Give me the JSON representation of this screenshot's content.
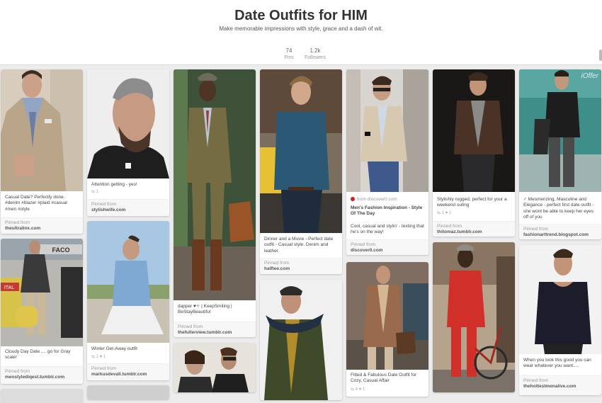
{
  "board": {
    "title": "Date Outfits for HIM",
    "description": "Make memorable impressions with style, grace and a dash of wit.",
    "pins_count": "74",
    "pins_label": "Pins",
    "followers_count": "1.2k",
    "followers_label": "Followers"
  },
  "pinned_from_label": "Pinned from",
  "pins": {
    "c1a": {
      "caption": "Casual Date? Perfectly done. #denim #blazer #plaid #casual #men #style",
      "source": "theultralinx.com"
    },
    "c1b": {
      "caption": "Cloudy Day Date .... go for Gray scale!",
      "source": "menstylediqest.tumblr.com"
    },
    "c2a": {
      "caption": "Attention getting - yes!",
      "counts": "⇆ 1",
      "source": "stylishwife.com"
    },
    "c2b": {
      "caption": "Winter Get-Away outfit",
      "counts": "⇆ 1    ♥ 1",
      "source": "markusdevall.tumblr.com"
    },
    "c3a": {
      "caption": "dapper ♥✧ | KeepSmiling | BeStayBeautiful",
      "source": "thefullerview.tumblr.com"
    },
    "c4a": {
      "caption": "Dinner and a Movie - Perfect date outfit - Casual style. Denim and leather.",
      "source": "halftee.com"
    },
    "c5a": {
      "from_text": "from discover0.com",
      "title": "Men's Fashion Inspiration - Style Of The Day",
      "caption": "Cool, casual and stylin' - texting that he's on the way!",
      "source": "discover0.com"
    },
    "c5b": {
      "caption": "Fitted & Fabulous Date Outfit for Cozy, Casual Affair",
      "counts": "⇆ 4    ♥ 1"
    },
    "c6a": {
      "caption": "Stylishly rugged, perfect for your a weekend outing",
      "counts": "⇆ 1    ♥ 1",
      "source": "thitomaz.tumblr.com"
    },
    "c7a": {
      "caption": "♂ Mesmerizing, Masculine and Elegance - perfect first date outfit - she wont be able to keep her eyes off of you",
      "source": "fashionarttrend.blogspot.com"
    },
    "c7b": {
      "caption": "When you look this good you can wear whatever you want.....",
      "source": "thehottestmenalive.com"
    }
  },
  "image_watermarks": {
    "c1b_sign": "FACO",
    "c1b_sign2": "ITAL",
    "c7a_corner": "iOffer"
  },
  "colors": {
    "accent": "#cb2027",
    "background": "#ececec"
  }
}
